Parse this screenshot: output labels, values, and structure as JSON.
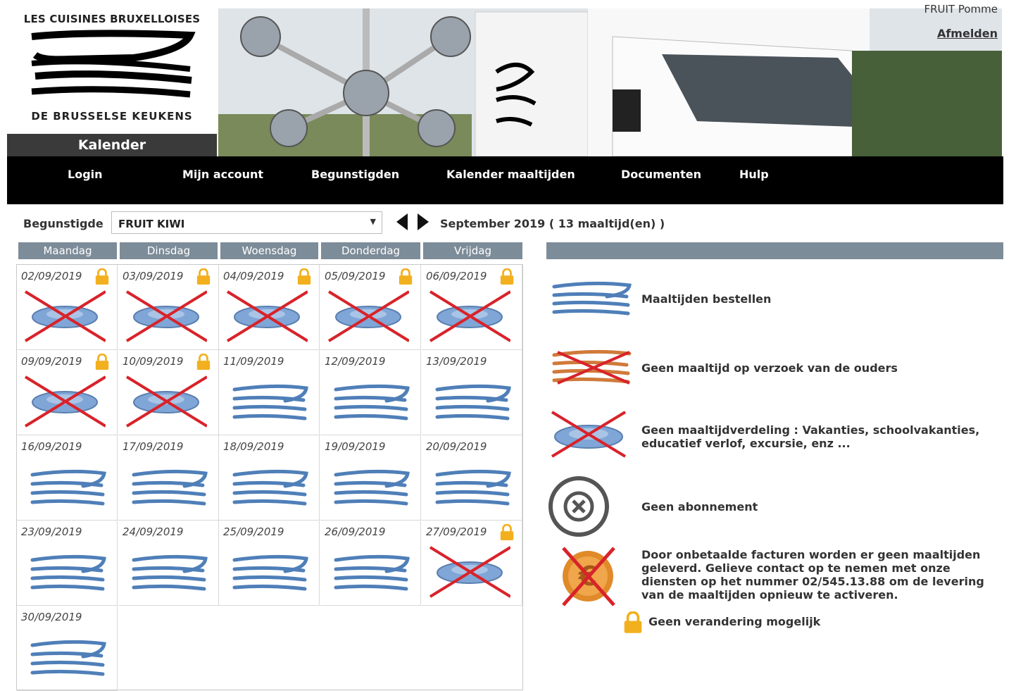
{
  "header": {
    "logo_top": "LES CUISINES BRUXELLOISES",
    "logo_bottom": "DE BRUSSELSE KEUKENS",
    "page_tab": "Kalender",
    "user_name": "FRUIT Pomme",
    "logout": "Afmelden"
  },
  "nav": [
    {
      "label": "Login"
    },
    {
      "label": "Mijn account"
    },
    {
      "label": "Begunstigden"
    },
    {
      "label": "Kalender maaltijden"
    },
    {
      "label": "Documenten"
    },
    {
      "label": "Hulp"
    }
  ],
  "controls": {
    "beneficiary_label": "Begunstigde",
    "beneficiary_value": "FRUIT KIWI",
    "month_title": "September 2019 ( 13 maaltijd(en) )"
  },
  "calendar": {
    "day_headers": [
      "Maandag",
      "Dinsdag",
      "Woensdag",
      "Donderdag",
      "Vrijdag"
    ],
    "days": [
      {
        "date": "02/09/2019",
        "status": "no-distribution",
        "locked": true
      },
      {
        "date": "03/09/2019",
        "status": "no-distribution",
        "locked": true
      },
      {
        "date": "04/09/2019",
        "status": "no-distribution",
        "locked": true
      },
      {
        "date": "05/09/2019",
        "status": "no-distribution",
        "locked": true
      },
      {
        "date": "06/09/2019",
        "status": "no-distribution",
        "locked": true
      },
      {
        "date": "09/09/2019",
        "status": "no-distribution",
        "locked": true
      },
      {
        "date": "10/09/2019",
        "status": "no-distribution",
        "locked": true
      },
      {
        "date": "11/09/2019",
        "status": "meal",
        "locked": false
      },
      {
        "date": "12/09/2019",
        "status": "meal",
        "locked": false
      },
      {
        "date": "13/09/2019",
        "status": "meal",
        "locked": false
      },
      {
        "date": "16/09/2019",
        "status": "meal",
        "locked": false
      },
      {
        "date": "17/09/2019",
        "status": "meal",
        "locked": false
      },
      {
        "date": "18/09/2019",
        "status": "meal",
        "locked": false
      },
      {
        "date": "19/09/2019",
        "status": "meal",
        "locked": false
      },
      {
        "date": "20/09/2019",
        "status": "meal",
        "locked": false
      },
      {
        "date": "23/09/2019",
        "status": "meal",
        "locked": false
      },
      {
        "date": "24/09/2019",
        "status": "meal",
        "locked": false
      },
      {
        "date": "25/09/2019",
        "status": "meal",
        "locked": false
      },
      {
        "date": "26/09/2019",
        "status": "meal",
        "locked": false
      },
      {
        "date": "27/09/2019",
        "status": "no-distribution",
        "locked": true
      },
      {
        "date": "30/09/2019",
        "status": "meal",
        "locked": false
      }
    ]
  },
  "legend": [
    {
      "icon": "meal-icon",
      "text": "Maaltijden bestellen"
    },
    {
      "icon": "parent-cancel-icon",
      "text": "Geen maaltijd op verzoek van de ouders"
    },
    {
      "icon": "no-distribution-icon",
      "text": "Geen maaltijdverdeling : Vakanties, schoolvakanties, educatief verlof, excursie, enz ..."
    },
    {
      "icon": "no-subscription-icon",
      "text": "Geen abonnement"
    },
    {
      "icon": "unpaid-euro-icon",
      "text": "Door onbetaalde facturen worden er geen maaltijden geleverd. Gelieve contact op te nemen met onze diensten op het nummer 02/545.13.88 om de levering van de maaltijden opnieuw te activeren."
    },
    {
      "icon": "lock-icon",
      "text": "Geen verandering mogelijk"
    }
  ],
  "colors": {
    "nav_bg": "#000000",
    "header_bar": "#7d8c99",
    "meal_blue": "#4f7fb8",
    "cross_red": "#d8232a",
    "lock_gold": "#f2b01e"
  }
}
